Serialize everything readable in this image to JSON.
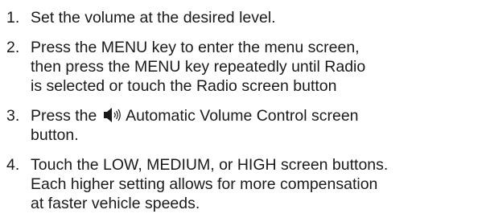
{
  "steps": [
    {
      "number": "1.",
      "text": "Set the volume at the desired level."
    },
    {
      "number": "2.",
      "text": "Press the MENU key to enter the menu screen,\nthen press the MENU key repeatedly until Radio\nis selected or touch the Radio screen button"
    },
    {
      "number": "3.",
      "text_before": "Press the ",
      "icon": "speaker-volume-icon",
      "text_after": " Automatic Volume Control screen\nbutton."
    },
    {
      "number": "4.",
      "text": "Touch the LOW, MEDIUM, or HIGH screen buttons.\nEach higher setting allows for more compensation\nat faster vehicle speeds."
    }
  ]
}
